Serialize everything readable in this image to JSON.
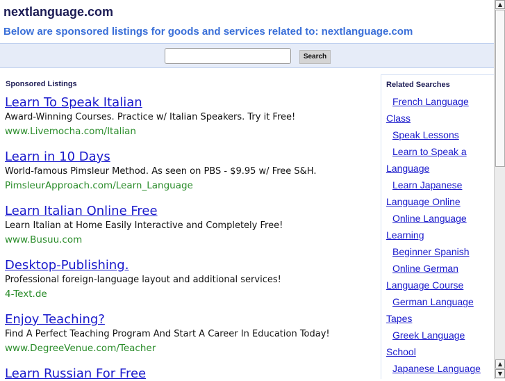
{
  "header": {
    "title": "nextlanguage.com",
    "subtitle": "Below are sponsored listings for goods and services related to: nextlanguage.com"
  },
  "search": {
    "value": "",
    "button": "Search"
  },
  "sponsored": {
    "heading": "Sponsored Listings",
    "ads": [
      {
        "title": "Learn To Speak Italian",
        "desc": "Award-Winning Courses. Practice w/ Italian Speakers. Try it Free!",
        "url": "www.Livemocha.com/Italian"
      },
      {
        "title": "Learn in 10 Days",
        "desc": "World-famous Pimsleur Method. As seen on PBS - $9.95 w/ Free S&H.",
        "url": "PimsleurApproach.com/Learn_Language"
      },
      {
        "title": "Learn Italian Online Free",
        "desc": "Learn Italian at Home Easily Interactive and Completely Free!",
        "url": "www.Busuu.com"
      },
      {
        "title": "Desktop-Publishing.",
        "desc": "Professional foreign-language layout and additional services!",
        "url": "4-Text.de"
      },
      {
        "title": "Enjoy Teaching?",
        "desc": "Find A Perfect Teaching Program And Start A Career In Education Today!",
        "url": "www.DegreeVenue.com/Teacher"
      },
      {
        "title": "Learn Russian For Free",
        "desc": "",
        "url": ""
      }
    ]
  },
  "related": {
    "heading": "Related Searches",
    "items": [
      "French Language Class",
      "Speak Lessons",
      "Learn to Speak a Language",
      "Learn Japanese Language Online",
      "Online Language Learning",
      "Beginner Spanish",
      "Online German Language Course",
      "German Language Tapes",
      "Greek Language School",
      "Japanese Language"
    ]
  }
}
